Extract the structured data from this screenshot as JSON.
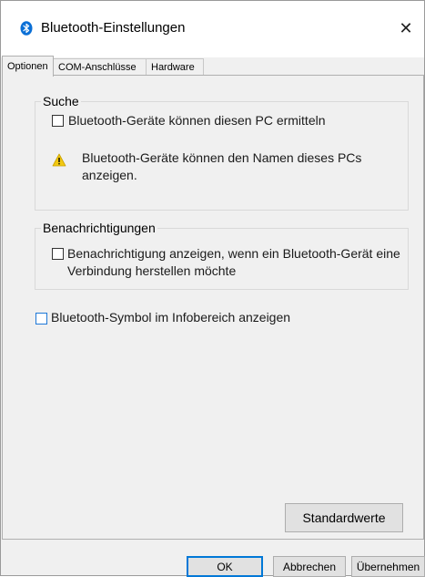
{
  "window": {
    "title": "Bluetooth-Einstellungen",
    "close_glyph": "✕"
  },
  "tabs": [
    {
      "label": "Optionen",
      "active": true
    },
    {
      "label": "COM-Anschlüsse",
      "active": false
    },
    {
      "label": "Hardware",
      "active": false
    }
  ],
  "search_group": {
    "legend": "Suche",
    "discover_checkbox": {
      "label": "Bluetooth-Geräte können diesen PC ermitteln",
      "checked": false
    },
    "warning_line1": "Bluetooth-Geräte können den Namen dieses PCs",
    "warning_line2": "anzeigen.",
    "warning_icon": "warning-triangle-icon"
  },
  "notifications_group": {
    "legend": "Benachrichtigungen",
    "notify_checkbox": {
      "label_line1": "Benachrichtigung anzeigen, wenn ein Bluetooth-Gerät eine",
      "label_line2": "Verbindung herstellen möchte",
      "checked": false
    }
  },
  "tray_checkbox": {
    "label": "Bluetooth-Symbol im Infobereich anzeigen",
    "checked": false
  },
  "buttons": {
    "defaults": "Standardwerte",
    "ok": "OK",
    "cancel": "Abbrechen",
    "apply": "Übernehmen"
  },
  "colors": {
    "bluetooth_blue": "#0a6fd6",
    "focus_blue": "#0078d7",
    "warning_yellow": "#f2c811"
  }
}
